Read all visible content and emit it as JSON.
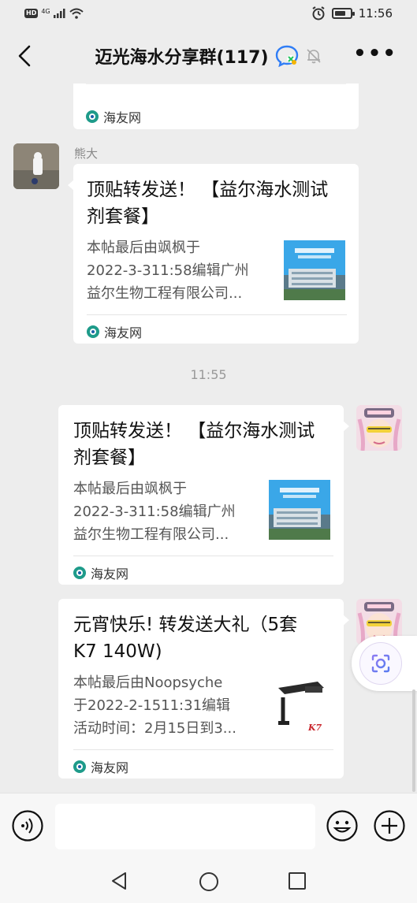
{
  "status_bar": {
    "network": "HD",
    "signal": "4G",
    "time": "11:56"
  },
  "header": {
    "title": "迈光海水分享群(117)",
    "icons": [
      "back-icon",
      "group-badge-icon",
      "mute-bell-icon",
      "more-icon"
    ]
  },
  "messages": [
    {
      "type": "link_card_partial",
      "source": "海友网"
    },
    {
      "sender": "熊大",
      "type": "link_card",
      "title": "顶贴转发送！ 【益尔海水测试剂套餐】",
      "title_lines": [
        "顶贴转发送！ 【益尔海水测试",
        "剂套餐】"
      ],
      "desc_lines": [
        "本帖最后由飒枫于",
        "2022-3-311:58编辑广州",
        "益尔生物工程有限公司..."
      ],
      "thumb_label": "公司全景 留学人员创业园",
      "source": "海友网"
    },
    {
      "type": "timestamp",
      "text": "11:55"
    },
    {
      "sender": "self",
      "type": "link_card",
      "title_lines": [
        "顶贴转发送！ 【益尔海水测试",
        "剂套餐】"
      ],
      "desc_lines": [
        "本帖最后由飒枫于",
        "2022-3-311:58编辑广州",
        "益尔生物工程有限公司..."
      ],
      "thumb_label": "公司全景 留学人员创业园",
      "source": "海友网"
    },
    {
      "sender": "self",
      "type": "link_card",
      "title_lines": [
        "元宵快乐! 转发送大礼（5套",
        "K7  140W)"
      ],
      "desc_lines": [
        "本帖最后由Noopsyche",
        "于2022-2-1511:31编辑",
        "活动时间：2月15日到3..."
      ],
      "thumb_label": "K7",
      "source": "海友网"
    }
  ],
  "input_bar": {
    "placeholder": "",
    "icons": [
      "voice-icon",
      "emoji-icon",
      "add-icon"
    ]
  },
  "nav_bar": {
    "icons": [
      "nav-back-icon",
      "nav-home-icon",
      "nav-recents-icon"
    ]
  },
  "colors": {
    "background": "#ededed",
    "card": "#ffffff",
    "source_icon": "#1e9b8a"
  }
}
